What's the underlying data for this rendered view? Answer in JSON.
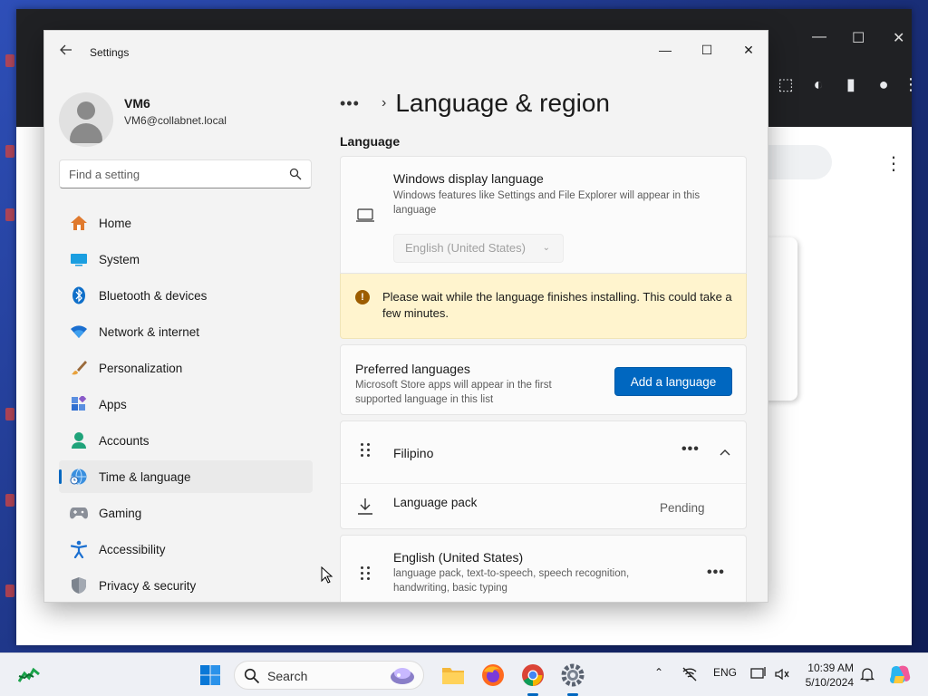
{
  "window": {
    "app_title": "Settings",
    "controls": {
      "minimize": "—",
      "maximize": "☐",
      "close": "✕"
    }
  },
  "user": {
    "name": "VM6",
    "email": "VM6@collabnet.local"
  },
  "search": {
    "placeholder": "Find a setting"
  },
  "sidebar": {
    "items": [
      {
        "label": "Home",
        "icon": "home-icon"
      },
      {
        "label": "System",
        "icon": "system-icon"
      },
      {
        "label": "Bluetooth & devices",
        "icon": "bluetooth-icon"
      },
      {
        "label": "Network & internet",
        "icon": "wifi-icon"
      },
      {
        "label": "Personalization",
        "icon": "brush-icon"
      },
      {
        "label": "Apps",
        "icon": "apps-icon"
      },
      {
        "label": "Accounts",
        "icon": "accounts-icon"
      },
      {
        "label": "Time & language",
        "icon": "globe-clock-icon",
        "active": true
      },
      {
        "label": "Gaming",
        "icon": "gamepad-icon"
      },
      {
        "label": "Accessibility",
        "icon": "accessibility-icon"
      },
      {
        "label": "Privacy & security",
        "icon": "shield-icon"
      }
    ]
  },
  "main": {
    "breadcrumb_dots": "•••",
    "breadcrumb_chevron": "›",
    "page_title": "Language & region",
    "section_label": "Language",
    "display_language": {
      "title": "Windows display language",
      "description": "Windows features like Settings and File Explorer will appear in this language",
      "selected": "English (United States)"
    },
    "warning": {
      "icon_glyph": "!",
      "text": "Please wait while the language finishes installing. This could take a few minutes."
    },
    "preferred": {
      "title": "Preferred languages",
      "description": "Microsoft Store apps will appear in the first supported language in this list",
      "button": "Add a language"
    },
    "languages": [
      {
        "name": "Filipino",
        "more": "•••",
        "sub_label": "Language pack",
        "sub_status": "Pending"
      },
      {
        "name": "English (United States)",
        "more": "•••",
        "description": "language pack, text-to-speech, speech recognition, handwriting, basic typing"
      }
    ]
  },
  "taskbar": {
    "search_label": "Search",
    "input_indicator": "ENG",
    "time": "10:39 AM",
    "date": "5/10/2024"
  },
  "colors": {
    "accent": "#0067c0",
    "warning_bg": "#fff4ce",
    "warning_icon": "#9d5d00"
  }
}
